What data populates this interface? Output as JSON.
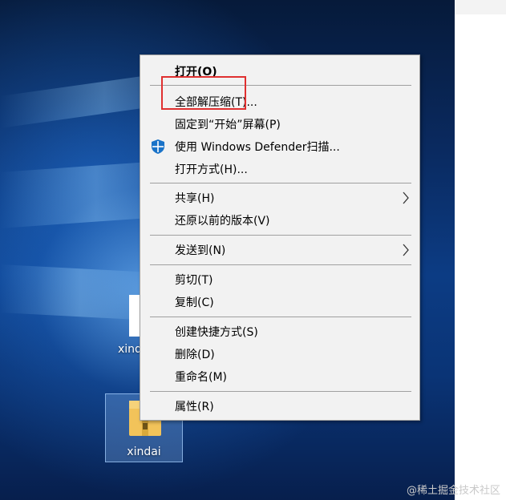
{
  "desktop": {
    "icons": [
      {
        "label": "xind"
      },
      {
        "label": "xindai"
      }
    ]
  },
  "context_menu": {
    "items": [
      {
        "label": "打开(O)"
      },
      {
        "label": "全部解压缩(T)..."
      },
      {
        "label": "固定到“开始”屏幕(P)"
      },
      {
        "label": "使用 Windows Defender扫描...",
        "icon": "windows-defender-shield-icon"
      },
      {
        "label": "打开方式(H)..."
      },
      {
        "label": "共享(H)"
      },
      {
        "label": "还原以前的版本(V)"
      },
      {
        "label": "发送到(N)"
      },
      {
        "label": "剪切(T)"
      },
      {
        "label": "复制(C)"
      },
      {
        "label": "创建快捷方式(S)"
      },
      {
        "label": "删除(D)"
      },
      {
        "label": "重命名(M)"
      },
      {
        "label": "属性(R)"
      }
    ]
  },
  "annotation": {
    "color": "#e03030"
  },
  "watermark": "@稀土掘金技术社区"
}
